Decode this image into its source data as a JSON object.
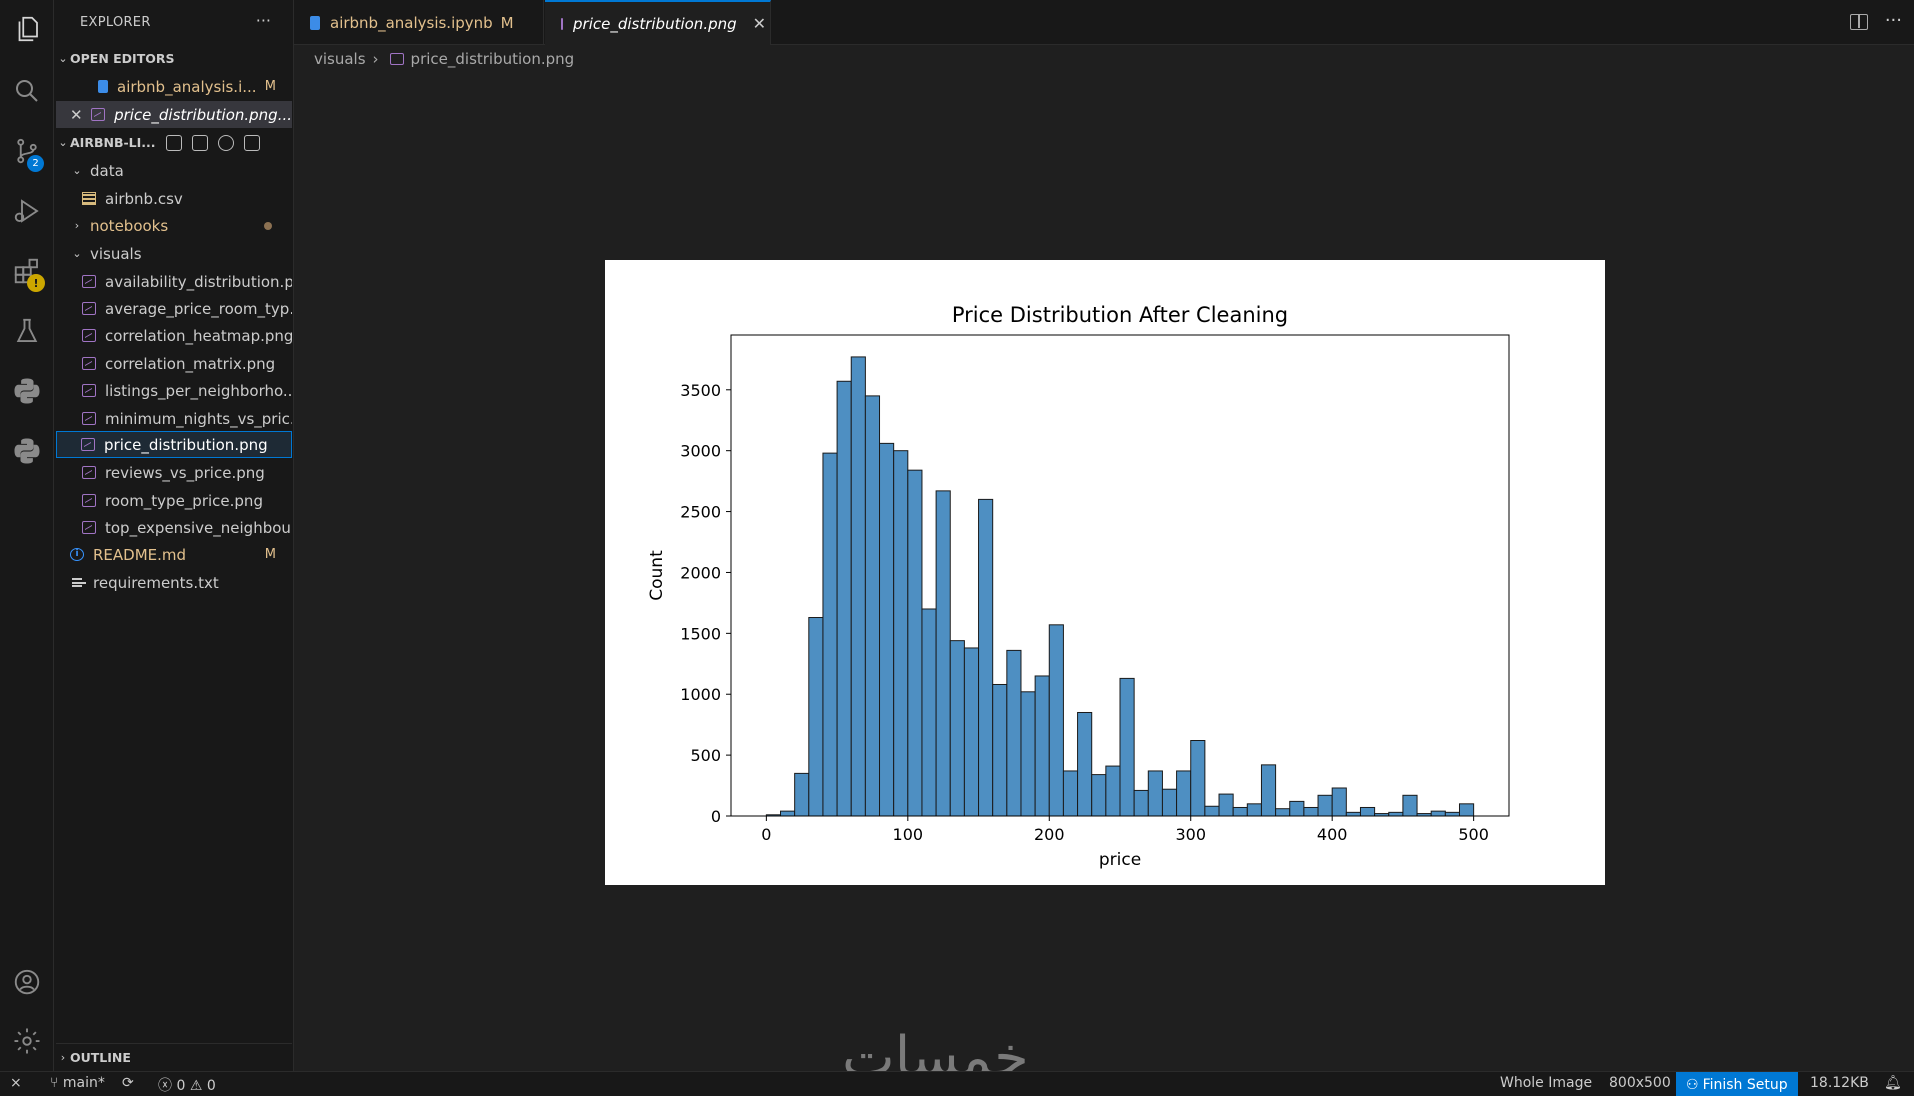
{
  "sidebar": {
    "title": "EXPLORER",
    "more": "···",
    "open_editors": {
      "header": "OPEN EDITORS",
      "items": [
        {
          "label": "airbnb_analysis.i...",
          "badge": "M"
        },
        {
          "label": "price_distribution.png..."
        }
      ]
    },
    "project": {
      "header": "AIRBNB-LI...",
      "items": [
        {
          "label": "data"
        },
        {
          "label": "airbnb.csv"
        },
        {
          "label": "notebooks"
        },
        {
          "label": "visuals"
        },
        {
          "label": "availability_distribution.p..."
        },
        {
          "label": "average_price_room_typ..."
        },
        {
          "label": "correlation_heatmap.png"
        },
        {
          "label": "correlation_matrix.png"
        },
        {
          "label": "listings_per_neighborho..."
        },
        {
          "label": "minimum_nights_vs_pric..."
        },
        {
          "label": "price_distribution.png"
        },
        {
          "label": "reviews_vs_price.png"
        },
        {
          "label": "room_type_price.png"
        },
        {
          "label": "top_expensive_neighbou..."
        },
        {
          "label": "README.md",
          "badge": "M"
        },
        {
          "label": "requirements.txt"
        }
      ]
    },
    "outline": "OUTLINE"
  },
  "activity": {
    "scm_badge": "2",
    "warn_badge": "!"
  },
  "tabs": [
    {
      "label": "airbnb_analysis.ipynb",
      "badge": "M"
    },
    {
      "label": "price_distribution.png",
      "close": "✕"
    }
  ],
  "breadcrumb": {
    "folder": "visuals",
    "file": "price_distribution.png",
    "sep": "›"
  },
  "watermark": "خمسات",
  "status": {
    "branch": "main*",
    "errors": "0",
    "warnings": "0",
    "mode": "Whole Image",
    "size": "800x500",
    "finish": "Finish Setup",
    "filesize": "18.12KB"
  },
  "chart_data": {
    "type": "bar",
    "title": "Price Distribution After Cleaning",
    "xlabel": "price",
    "ylabel": "Count",
    "xlim": [
      -25,
      525
    ],
    "ylim": [
      0,
      3950
    ],
    "xticks": [
      0,
      100,
      200,
      300,
      400,
      500
    ],
    "yticks": [
      0,
      500,
      1000,
      1500,
      2000,
      2500,
      3000,
      3500
    ],
    "bin_start": 0,
    "bin_width": 10,
    "values": [
      10,
      40,
      350,
      1630,
      2980,
      3570,
      3770,
      3450,
      3060,
      3000,
      2840,
      1700,
      2670,
      1440,
      1380,
      2600,
      1080,
      1360,
      1020,
      1150,
      1570,
      370,
      850,
      340,
      410,
      1130,
      210,
      370,
      220,
      370,
      620,
      80,
      180,
      70,
      100,
      420,
      60,
      120,
      70,
      170,
      230,
      30,
      70,
      20,
      30,
      170,
      20,
      40,
      30,
      100
    ],
    "color": "#4e8fc2",
    "grid": false
  }
}
